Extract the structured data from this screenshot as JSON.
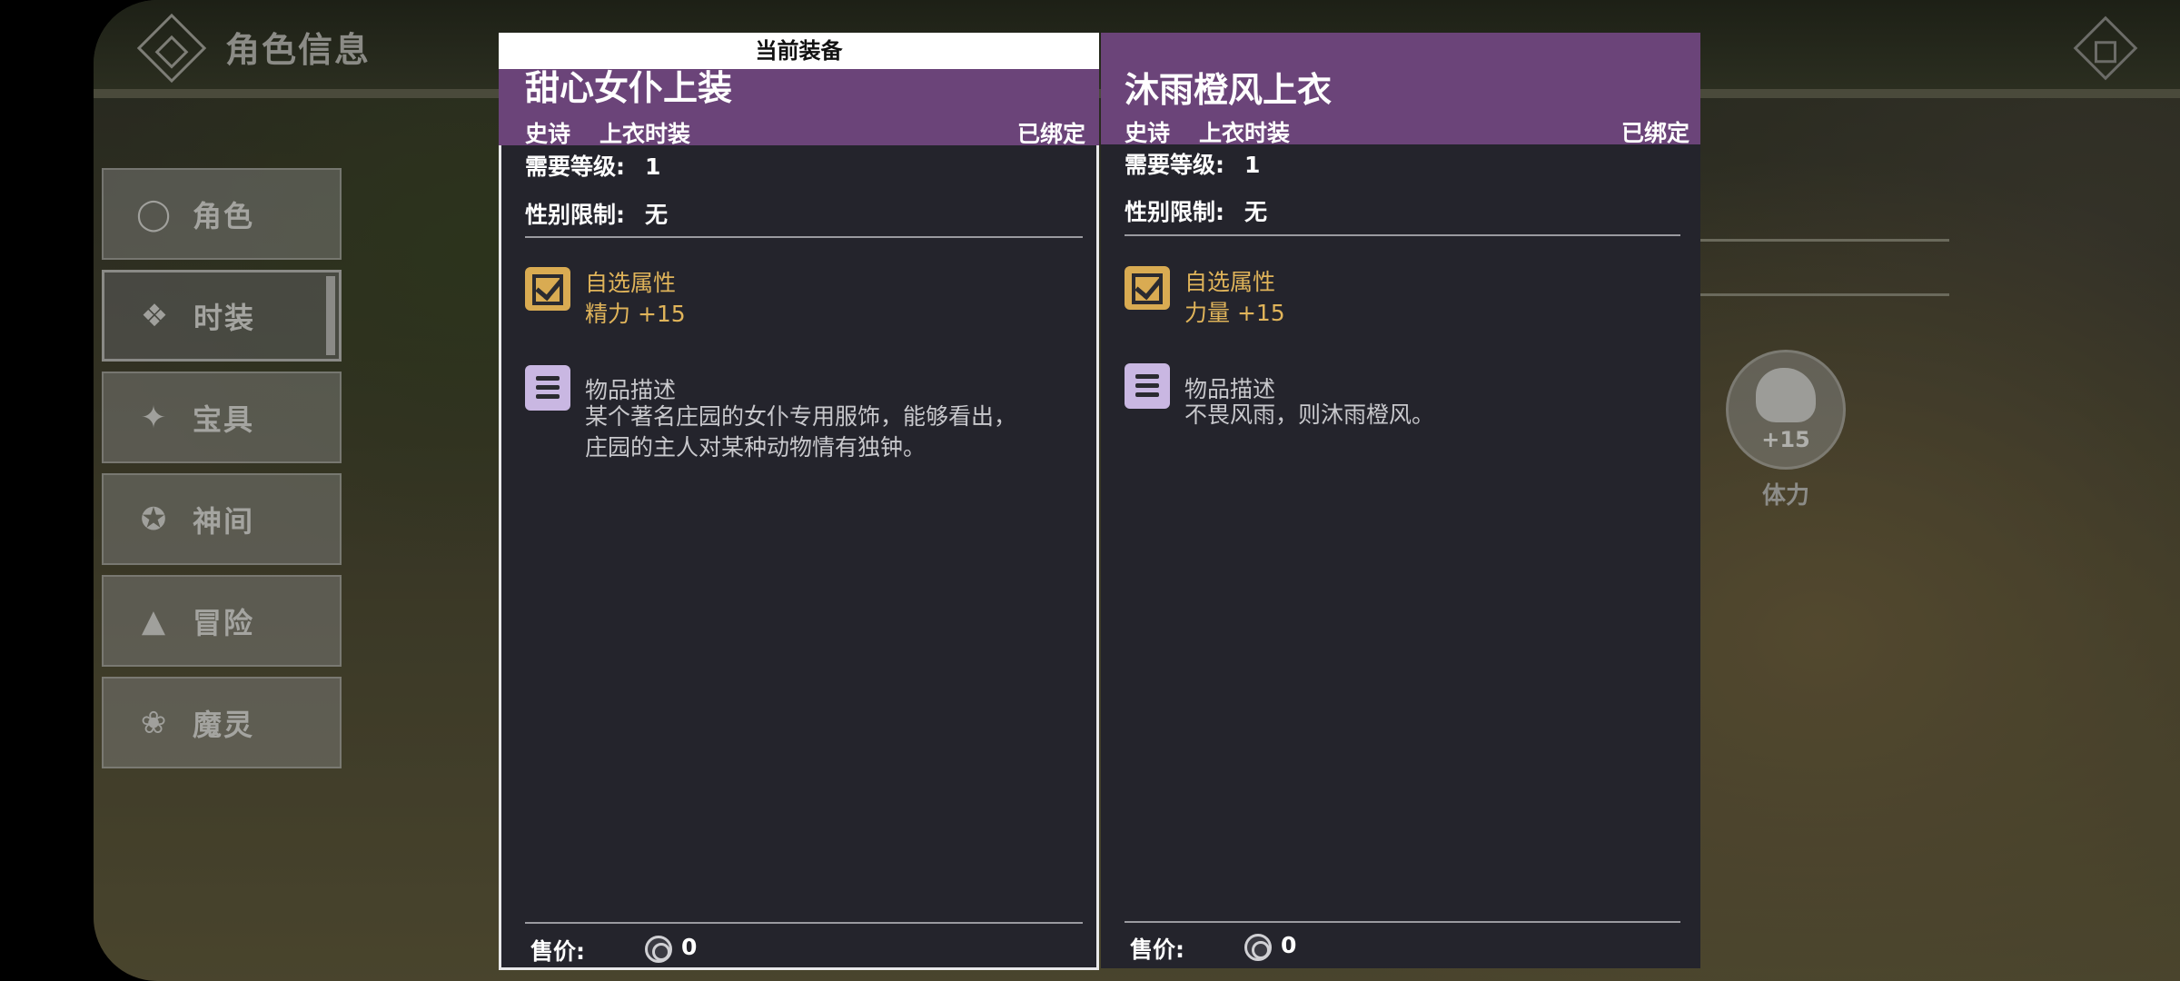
{
  "header": {
    "title": "角色信息"
  },
  "sidebar": {
    "items": [
      {
        "label": "角色",
        "icon": "character-icon"
      },
      {
        "label": "时装",
        "icon": "costume-icon",
        "active": true
      },
      {
        "label": "宝具",
        "icon": "treasure-icon"
      },
      {
        "label": "神间",
        "icon": "divine-icon"
      },
      {
        "label": "冒险",
        "icon": "adventure-icon"
      },
      {
        "label": "魔灵",
        "icon": "paw-icon"
      }
    ]
  },
  "background_stat": {
    "value": "+15",
    "label": "体力",
    "icon": "fist-icon"
  },
  "current_item": {
    "tag": "当前装备",
    "name": "甜心女仆上装",
    "rarity": "史诗",
    "slot": "上衣时装",
    "bound": "已绑定",
    "level_label": "需要等级:",
    "level_value": "1",
    "gender_label": "性别限制:",
    "gender_value": "无",
    "attr_title": "自选属性",
    "attr_value": "精力 +15",
    "desc_title": "物品描述",
    "desc_line1": "某个著名庄园的女仆专用服饰，能够看出，",
    "desc_line2": "庄园的主人对某种动物情有独钟。",
    "price_label": "售价:",
    "price_value": "0"
  },
  "compare_item": {
    "name": "沐雨橙风上衣",
    "rarity": "史诗",
    "slot": "上衣时装",
    "bound": "已绑定",
    "level_label": "需要等级:",
    "level_value": "1",
    "gender_label": "性别限制:",
    "gender_value": "无",
    "attr_title": "自选属性",
    "attr_value": "力量 +15",
    "desc_title": "物品描述",
    "desc_line1": "不畏风雨，则沐雨橙风。",
    "price_label": "售价:",
    "price_value": "0"
  },
  "colors": {
    "rarity_purple": "#6b4479",
    "panel_bg": "#24242c",
    "attr_gold": "#e0b45a",
    "desc_lavender": "#c9b7e2"
  }
}
